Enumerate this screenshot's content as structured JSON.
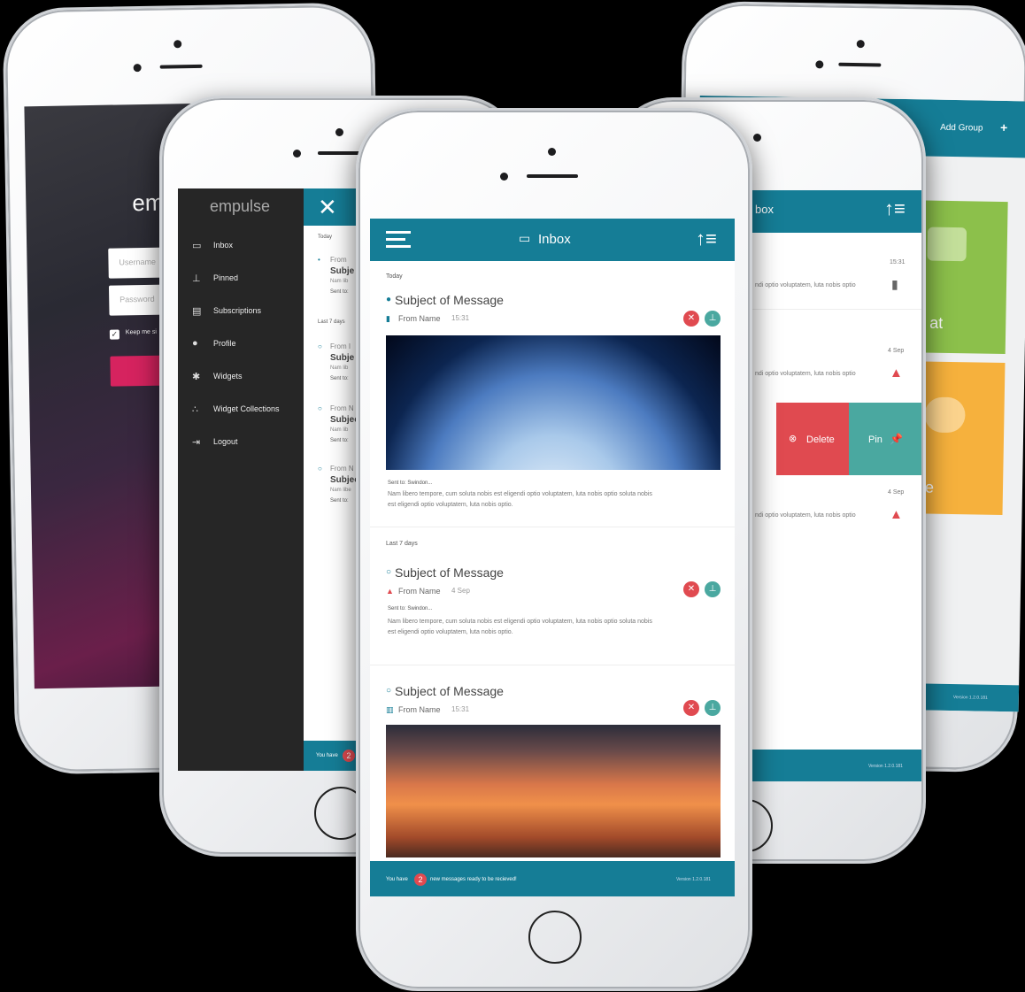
{
  "login": {
    "logo_partial": "em",
    "username_placeholder": "Username",
    "password_placeholder": "Password",
    "keep_signed": "Keep me si"
  },
  "menu": {
    "logo": "empulse",
    "items": [
      {
        "label": "Inbox",
        "icon": "inbox-icon"
      },
      {
        "label": "Pinned",
        "icon": "pin-icon"
      },
      {
        "label": "Subscriptions",
        "icon": "newspaper-icon"
      },
      {
        "label": "Profile",
        "icon": "user-icon"
      },
      {
        "label": "Widgets",
        "icon": "gear-icon"
      },
      {
        "label": "Widget Collections",
        "icon": "cubes-icon"
      },
      {
        "label": "Logout",
        "icon": "logout-icon"
      }
    ],
    "behind": {
      "today": "Today",
      "last7": "Last 7 days",
      "rows": [
        {
          "from": "From",
          "subject": "Subje",
          "body": "Nam lib",
          "sent": "Sent to:"
        },
        {
          "from": "From I",
          "subject": "Subje",
          "body": "Nam lib",
          "sent": "Sent to:"
        },
        {
          "from": "From N",
          "subject": "Subjec",
          "body": "Nam lib",
          "sent": "Sent to:"
        },
        {
          "from": "From N",
          "subject": "Subjec",
          "body": "Nam libe",
          "sent": "Sent to:"
        }
      ],
      "footer_text": "You have",
      "footer_count": "2"
    }
  },
  "main": {
    "title": "Inbox",
    "sections": {
      "today": "Today",
      "last7": "Last 7 days"
    },
    "messages": [
      {
        "subject": "Subject of Message",
        "from": "From Name",
        "time": "15:31",
        "sent": "Sent to: Swindon...",
        "body1": "Nam libero tempore, cum soluta nobis est eligendi optio voluptatem, luta nobis optio soluta nobis",
        "body2": "est eligendi optio voluptatem, luta nobis optio."
      },
      {
        "subject": "Subject of Message",
        "from": "From Name",
        "time": "4 Sep",
        "sent": "Sent to: Swindon...",
        "body1": "Nam libero tempore, cum soluta nobis est eligendi optio voluptatem, luta nobis optio soluta nobis",
        "body2": "est eligendi optio voluptatem, luta nobis optio."
      },
      {
        "subject": "Subject of Message",
        "from": "From Name",
        "time": "15:31"
      }
    ],
    "footer": {
      "prefix": "You have",
      "count": "2",
      "suffix": "new messages ready to be recieved!",
      "version": "Version 1.2.0.181"
    }
  },
  "swipe": {
    "title_partial": "box",
    "rows": [
      {
        "time": "15:31",
        "text": "ndi optio voluptatem, luta nobis optio"
      },
      {
        "time": "4 Sep",
        "text": "ndi optio voluptatem, luta nobis optio"
      },
      {
        "time": "4 Sep",
        "text": "ndi optio voluptatem, luta nobis optio"
      }
    ],
    "delete_label": "Delete",
    "pin_label": "Pin",
    "version": "Version 1.2.0.181"
  },
  "dashboard": {
    "add_group": "Add Group",
    "tile1_partial": "at",
    "tile2_partial": "e",
    "version": "Version 1.2.0.181"
  },
  "colors": {
    "teal": "#157d96",
    "red": "#e04a50",
    "green": "#8cc04b",
    "orange": "#f6b13d",
    "pin": "#4aa8a0"
  }
}
